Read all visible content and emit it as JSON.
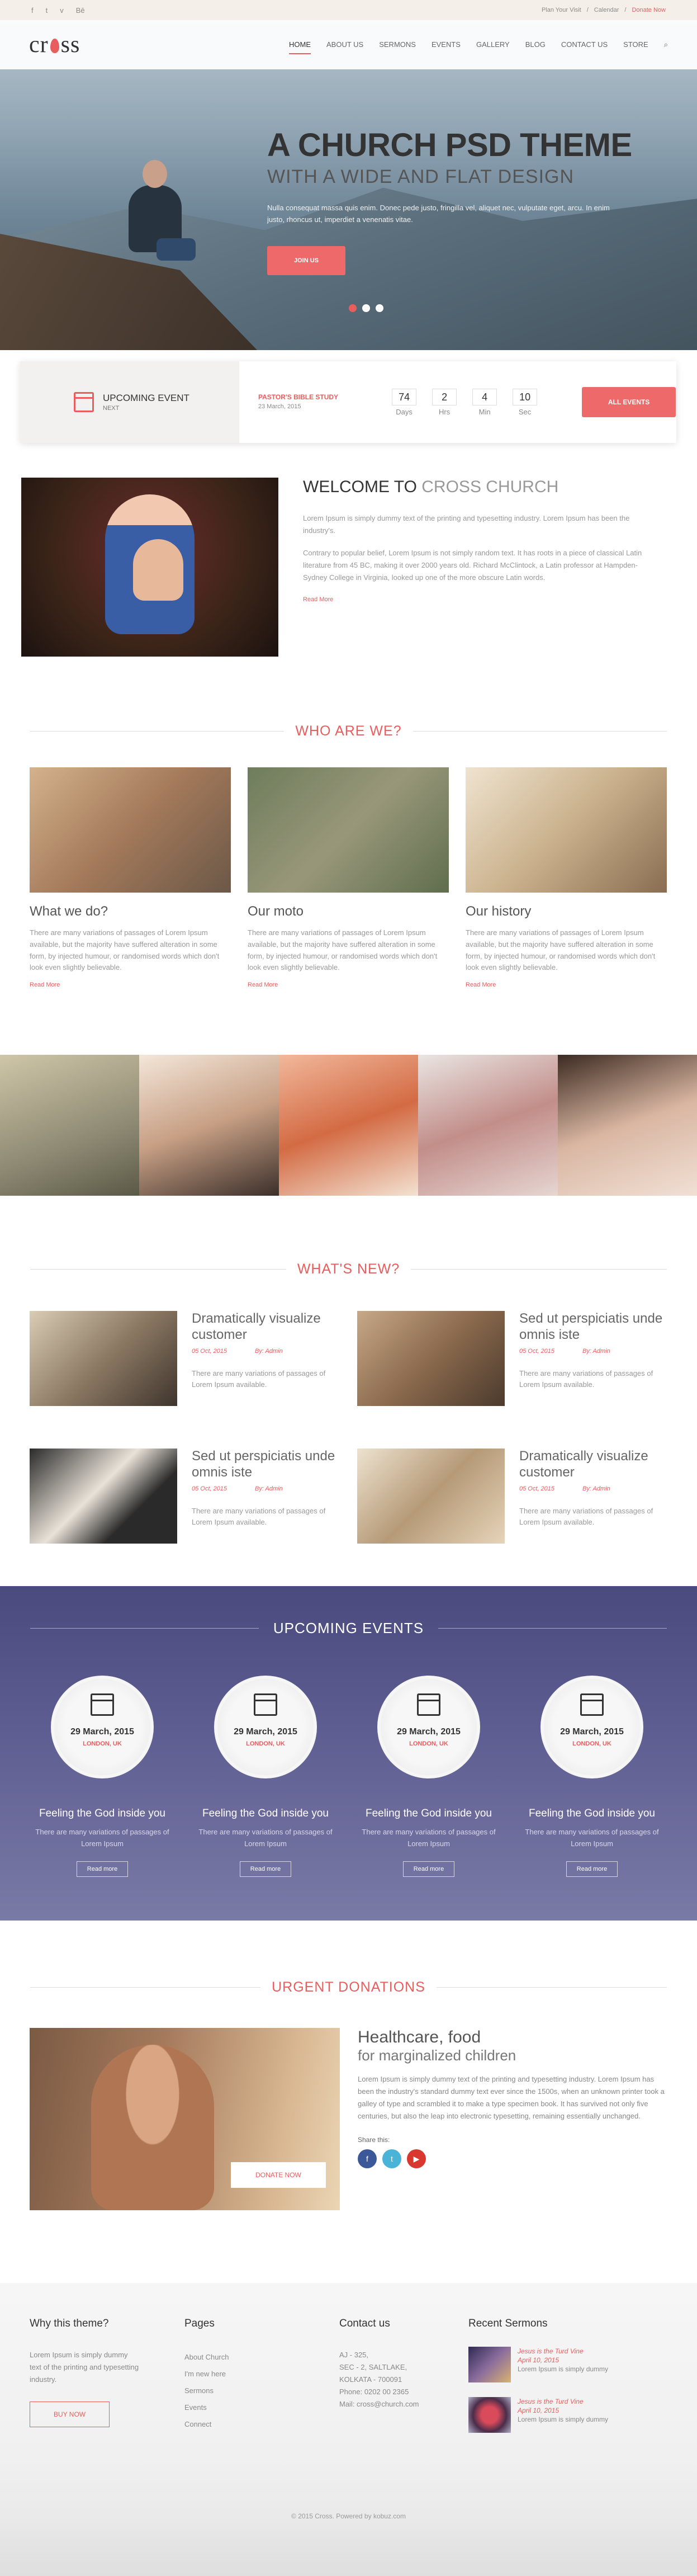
{
  "topbar": {
    "social": [
      "f",
      "t",
      "v",
      "Bē"
    ],
    "links": [
      "Plan Your Visit",
      "Calendar",
      "Donate Now"
    ],
    "separators": [
      "/",
      "/"
    ]
  },
  "header": {
    "logo_left": "cr",
    "logo_right": "ss",
    "nav": [
      "HOME",
      "ABOUT US",
      "SERMONS",
      "EVENTS",
      "GALLERY",
      "BLOG",
      "CONTACT US",
      "STORE"
    ],
    "search_icon": "⌕"
  },
  "hero": {
    "title": "A CHURCH PSD THEME",
    "subtitle": "WITH A WIDE AND FLAT DESIGN",
    "text": "Nulla consequat massa quis enim. Donec pede justo, fringilla vel, aliquet nec, vulputate eget, arcu. In enim justo, rhoncus ut, imperdiet a venenatis vitae.",
    "button": "JOIN US"
  },
  "upcoming": {
    "title": "UPCOMING EVENT",
    "next": "NEXT",
    "event_name": "PASTOR'S BIBLE STUDY",
    "event_date": "23 March, 2015",
    "countdown": [
      {
        "n": "74",
        "u": "Days"
      },
      {
        "n": "2",
        "u": "Hrs"
      },
      {
        "n": "4",
        "u": "Min"
      },
      {
        "n": "10",
        "u": "Sec"
      }
    ],
    "all_button": "ALL EVENTS"
  },
  "welcome": {
    "title_a": "WELCOME TO ",
    "title_b": "CROSS CHURCH",
    "p1": "Lorem Ipsum is simply dummy text of the printing and typesetting industry. Lorem Ipsum has been the industry's.",
    "p2": "Contrary to popular belief, Lorem Ipsum is not simply random text. It has roots in a piece of classical Latin literature from 45 BC, making it over 2000 years old. Richard McClintock, a Latin professor at Hampden-Sydney College in Virginia, looked up one of the more obscure Latin words.",
    "readmore": "Read More"
  },
  "who": {
    "title": "WHO ARE WE?",
    "cols": [
      {
        "h": "What we do?",
        "p": "There are many variations of passages of Lorem Ipsum available, but the majority have suffered alteration in some form, by injected humour, or randomised words which don't look even slightly believable.",
        "more": "Read More"
      },
      {
        "h": "Our moto",
        "p": "There are many variations of passages of Lorem Ipsum available, but the majority have suffered alteration in some form, by injected humour, or randomised words which don't look even slightly believable.",
        "more": "Read More"
      },
      {
        "h": "Our history",
        "p": "There are many variations of passages of Lorem Ipsum available, but the majority have suffered alteration in some form, by injected humour, or randomised words which don't look even slightly believable.",
        "more": "Read More"
      }
    ]
  },
  "news": {
    "title": "WHAT'S NEW?",
    "items": [
      {
        "h": "Dramatically visualize customer",
        "date": "05 Oct, 2015",
        "by": "By: Admin",
        "p": "There are many variations of passages of Lorem Ipsum available."
      },
      {
        "h": "Sed ut perspiciatis unde omnis iste",
        "date": "05 Oct, 2015",
        "by": "By: Admin",
        "p": "There are many variations of passages of Lorem Ipsum available."
      },
      {
        "h": "Sed ut perspiciatis unde omnis iste",
        "date": "05 Oct, 2015",
        "by": "By: Admin",
        "p": "There are many variations of passages of Lorem Ipsum available."
      },
      {
        "h": "Dramatically visualize customer",
        "date": "05 Oct, 2015",
        "by": "By: Admin",
        "p": "There are many variations of passages of Lorem Ipsum available."
      }
    ]
  },
  "events": {
    "title": "UPCOMING EVENTS",
    "items": [
      {
        "date": "29 March, 2015",
        "loc": "LONDON, UK",
        "h": "Feeling the God inside you",
        "p": "There are many variations of passages of Lorem Ipsum",
        "more": "Read more"
      },
      {
        "date": "29 March, 2015",
        "loc": "LONDON, UK",
        "h": "Feeling the God inside you",
        "p": "There are many variations of passages of Lorem Ipsum",
        "more": "Read more"
      },
      {
        "date": "29 March, 2015",
        "loc": "LONDON, UK",
        "h": "Feeling the God inside you",
        "p": "There are many variations of passages of Lorem Ipsum",
        "more": "Read more"
      },
      {
        "date": "29 March, 2015",
        "loc": "LONDON, UK",
        "h": "Feeling the God inside you",
        "p": "There are many variations of passages of Lorem Ipsum",
        "more": "Read more"
      }
    ]
  },
  "donation": {
    "title": "URGENT DONATIONS",
    "h": "Healthcare, food",
    "h2": "for marginalized children",
    "p": "Lorem Ipsum is simply dummy text of the printing and typesetting industry. Lorem Ipsum has been the industry's standard dummy text ever since the 1500s, when an unknown printer took a galley of type and scrambled it to make a type specimen book. It has survived not only five centuries, but also the leap into electronic typesetting, remaining essentially unchanged.",
    "share": "Share this:",
    "button": "DONATE NOW",
    "share_icons": [
      "f",
      "t",
      "▶"
    ]
  },
  "footer": {
    "why": {
      "h": "Why this theme?",
      "p": "Lorem Ipsum is simply dummy text of the printing and typesetting industry.",
      "btn": "BUY NOW"
    },
    "pages": {
      "h": "Pages",
      "items": [
        "About Church",
        "I'm new here",
        "Sermons",
        "Events",
        "Connect"
      ]
    },
    "contact": {
      "h": "Contact us",
      "lines": [
        "AJ - 325,",
        "SEC - 2, SALTLAKE,",
        "KOLKATA - 700091",
        "Phone: 0202 00 2365",
        "Mail: cross@church.com"
      ]
    },
    "sermons": {
      "h": "Recent Sermons",
      "items": [
        {
          "t": "Jesus is the Turd Vine",
          "d": "April 10, 2015",
          "x": "Lorem Ipsum is simply dummy"
        },
        {
          "t": "Jesus is the Turd Vine",
          "d": "April 10, 2015",
          "x": "Lorem Ipsum is simply dummy"
        }
      ]
    },
    "copy": "© 2015 Cross. Powered by kobuz.com"
  },
  "colors": {
    "accent": "#e85d5d",
    "events_bg": "#5f5e92"
  }
}
